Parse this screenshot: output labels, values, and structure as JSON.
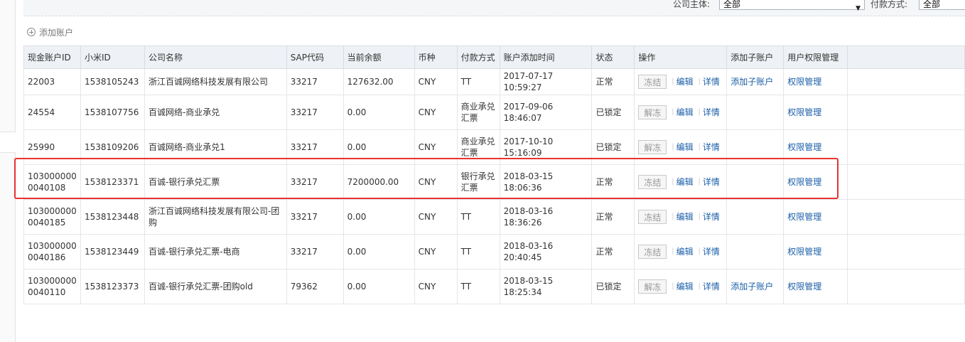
{
  "filters": {
    "company_label": "公司主体:",
    "company_value": "全部",
    "payment_label": "付款方式:",
    "payment_value": "全部"
  },
  "toolbar": {
    "add_account_label": "添加账户"
  },
  "icons": {
    "add": "plus-circle-icon",
    "dropdown": "chevron-down-icon"
  },
  "accent_colors": {
    "link": "#1a5ea8",
    "highlight": "#e8322f"
  },
  "table": {
    "headers": [
      "现金账户ID",
      "小米ID",
      "公司名称",
      "SAP代码",
      "当前余额",
      "币种",
      "付款方式",
      "账户添加时间",
      "状态",
      "操作",
      "添加子账户",
      "用户权限管理"
    ],
    "edit_label": "编辑",
    "detail_label": "详情",
    "rows": [
      {
        "account_id": "22003",
        "mi_id": "1538105243",
        "company": "浙江百诚网络科技发展有限公司",
        "sap": "33217",
        "balance": "127632.00",
        "currency": "CNY",
        "payment": "TT",
        "time": "2017-07-17 10:59:27",
        "status": "正常",
        "action": "冻结",
        "sub_account": "添加子账户",
        "perm": "权限管理"
      },
      {
        "account_id": "24554",
        "mi_id": "1538107756",
        "company": "百诚网络-商业承兑",
        "sap": "33217",
        "balance": "0.00",
        "currency": "CNY",
        "payment": "商业承兑汇票",
        "time": "2017-09-06 18:46:07",
        "status": "已锁定",
        "action": "解冻",
        "sub_account": "",
        "perm": "权限管理"
      },
      {
        "account_id": "25990",
        "mi_id": "1538109206",
        "company": "百诚网络-商业承兑1",
        "sap": "33217",
        "balance": "0.00",
        "currency": "CNY",
        "payment": "商业承兑汇票",
        "time": "2017-10-10 15:16:09",
        "status": "已锁定",
        "action": "解冻",
        "sub_account": "",
        "perm": "权限管理"
      },
      {
        "account_id": "1030000000040108",
        "mi_id": "1538123371",
        "company": "百诚-银行承兑汇票",
        "sap": "33217",
        "balance": "7200000.00",
        "currency": "CNY",
        "payment": "银行承兑汇票",
        "time": "2018-03-15 18:06:36",
        "status": "正常",
        "action": "冻结",
        "sub_account": "",
        "perm": "权限管理"
      },
      {
        "account_id": "1030000000040185",
        "mi_id": "1538123448",
        "company": "浙江百诚网络科技发展有限公司-团购",
        "sap": "33217",
        "balance": "0.00",
        "currency": "CNY",
        "payment": "TT",
        "time": "2018-03-16 18:36:26",
        "status": "正常",
        "action": "冻结",
        "sub_account": "",
        "perm": "权限管理"
      },
      {
        "account_id": "1030000000040186",
        "mi_id": "1538123449",
        "company": "百诚-银行承兑汇票-电商",
        "sap": "33217",
        "balance": "0.00",
        "currency": "CNY",
        "payment": "TT",
        "time": "2018-03-16 20:40:45",
        "status": "正常",
        "action": "冻结",
        "sub_account": "",
        "perm": "权限管理"
      },
      {
        "account_id": "1030000000040110",
        "mi_id": "1538123373",
        "company": "百诚-银行承兑汇票-团购old",
        "sap": "79362",
        "balance": "0.00",
        "currency": "CNY",
        "payment": "TT",
        "time": "2018-03-15 18:25:34",
        "status": "已锁定",
        "action": "解冻",
        "sub_account": "添加子账户",
        "perm": "权限管理"
      }
    ]
  }
}
